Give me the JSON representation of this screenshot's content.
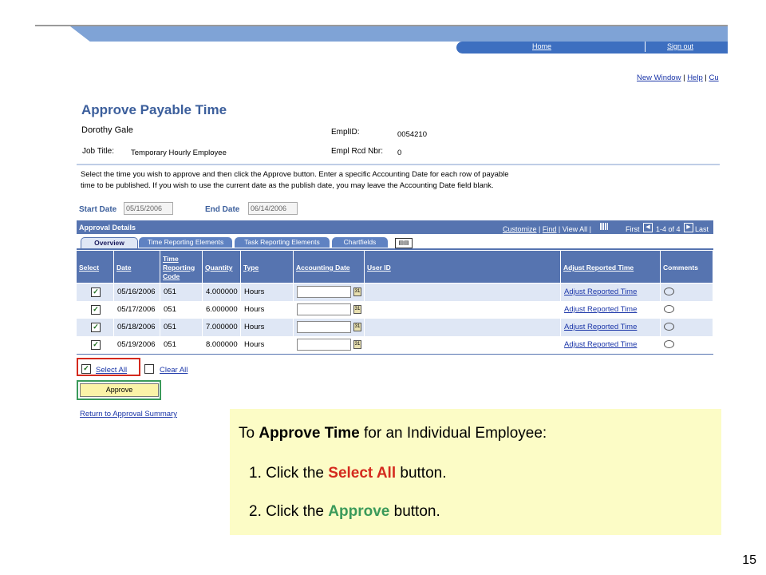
{
  "header": {
    "home": "Home",
    "sign_out": "Sign out",
    "links": [
      "New Window",
      "Help",
      "Cu"
    ],
    "separator": "|"
  },
  "page": {
    "title": "Approve Payable Time",
    "employee_name": "Dorothy Gale",
    "job_title_label": "Job Title:",
    "job_title": "Temporary Hourly Employee",
    "emplid_label": "EmplID:",
    "emplid": "0054210",
    "empl_rcd_label": "Empl Rcd Nbr:",
    "empl_rcd": "0",
    "instructions_1": "Select the time you wish to approve and then click the Approve button.  Enter a specific Accounting Date for each row of payable",
    "instructions_2": "time to be published.  If you wish to use the current date as the publish date, you may leave the Accounting Date field blank.",
    "start_date_label": "Start Date",
    "start_date": "05/15/2006",
    "end_date_label": "End Date",
    "end_date": "06/14/2006"
  },
  "grid": {
    "title": "Approval Details",
    "customize": "Customize",
    "find": "Find",
    "view_all": "View All",
    "first": "First",
    "range": "1-4 of 4",
    "last": "Last",
    "tabs": [
      "Overview",
      "Time Reporting Elements",
      "Task Reporting Elements",
      "Chartfields"
    ],
    "columns": [
      "Select",
      "Date",
      "Time Reporting Code",
      "Quantity",
      "Type",
      "Accounting Date",
      "User ID",
      "Adjust Reported Time",
      "Comments"
    ],
    "rows": [
      {
        "checked": "✓",
        "date": "05/16/2006",
        "trc": "051",
        "quantity": "4.000000",
        "type": "Hours",
        "adjust": "Adjust Reported Time"
      },
      {
        "checked": "✓",
        "date": "05/17/2006",
        "trc": "051",
        "quantity": "6.000000",
        "type": "Hours",
        "adjust": "Adjust Reported Time"
      },
      {
        "checked": "✓",
        "date": "05/18/2006",
        "trc": "051",
        "quantity": "7.000000",
        "type": "Hours",
        "adjust": "Adjust Reported Time"
      },
      {
        "checked": "✓",
        "date": "05/19/2006",
        "trc": "051",
        "quantity": "8.000000",
        "type": "Hours",
        "adjust": "Adjust Reported Time"
      }
    ]
  },
  "actions": {
    "select_all": "Select All",
    "clear_all": "Clear All",
    "approve": "Approve",
    "return_link": "Return to Approval Summary"
  },
  "callout": {
    "intro_pre": "To ",
    "intro_bold": "Approve Time",
    "intro_post": " for an Individual Employee:",
    "step1_pre": "1. Click the ",
    "step1_em": "Select All",
    "step1_post": " button.",
    "step2_pre": "2. Click the ",
    "step2_em": "Approve",
    "step2_post": " button.",
    "step1_color": "#d42a1e",
    "step2_color": "#3a9a5a"
  },
  "slide_number": "15",
  "colors": {
    "grid_header": "#5674b0",
    "title": "#3c5f9c",
    "callout_bg": "#fcfcc6"
  }
}
